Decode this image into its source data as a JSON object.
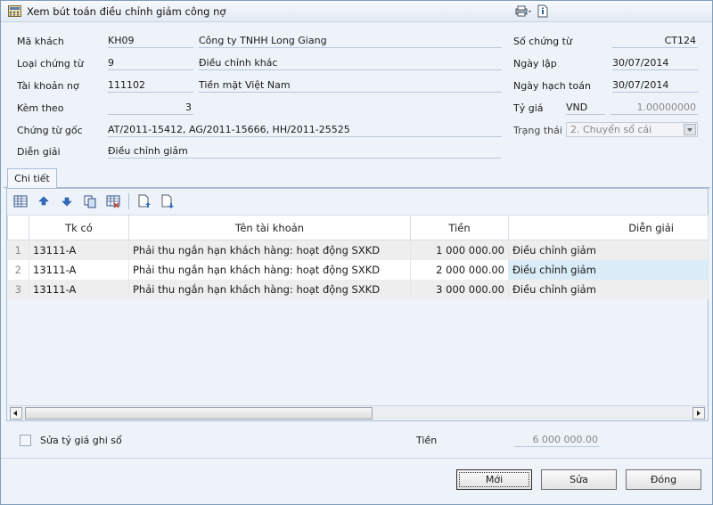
{
  "window": {
    "title": "Xem bút toán điều chỉnh giảm công nợ"
  },
  "header": {
    "ma_khach": {
      "label": "Mã khách",
      "code": "KH09",
      "name": "Công ty TNHH Long Giang"
    },
    "loai_chung_tu": {
      "label": "Loại chứng từ",
      "code": "9",
      "name": "Điều chỉnh khác"
    },
    "tai_khoan_no": {
      "label": "Tài khoản nợ",
      "code": "111102",
      "name": "Tiền mặt Việt Nam"
    },
    "kem_theo": {
      "label": "Kèm theo",
      "value": "3"
    },
    "chung_tu_goc": {
      "label": "Chứng từ gốc",
      "value": "AT/2011-15412, AG/2011-15666, HH/2011-25525"
    },
    "dien_giai": {
      "label": "Diễn giải",
      "value": "Điều chỉnh giảm"
    },
    "so_chung_tu": {
      "label": "Số chứng từ",
      "value": "CT124"
    },
    "ngay_lap": {
      "label": "Ngày lập",
      "value": "30/07/2014"
    },
    "ngay_hach_toan": {
      "label": "Ngày hạch toán",
      "value": "30/07/2014"
    },
    "ty_gia": {
      "label": "Tỷ giá",
      "currency": "VND",
      "rate": "1.00000000"
    },
    "trang_thai": {
      "label": "Trạng thái",
      "value": "2. Chuyển sổ cái"
    }
  },
  "tabs": [
    {
      "label": "Chi tiết"
    }
  ],
  "grid": {
    "columns": [
      "Tk có",
      "Tên tài khoản",
      "Tiền",
      "Diễn giải"
    ],
    "rows": [
      {
        "rn": "1",
        "tk_co": "13111-A",
        "ten_tk": "Phải thu ngắn hạn khách hàng: hoạt động SXKD",
        "tien": "1 000 000.00",
        "dien_giai": "Điều chỉnh giảm"
      },
      {
        "rn": "2",
        "tk_co": "13111-A",
        "ten_tk": "Phải thu ngắn hạn khách hàng: hoạt động SXKD",
        "tien": "2 000 000.00",
        "dien_giai": "Điều chỉnh giảm"
      },
      {
        "rn": "3",
        "tk_co": "13111-A",
        "ten_tk": "Phải thu ngắn hạn khách hàng: hoạt động SXKD",
        "tien": "3 000 000.00",
        "dien_giai": "Điều chỉnh giảm"
      }
    ]
  },
  "footer": {
    "sua_ty_gia_label": "Sửa tỷ giá ghi sổ",
    "tien_label": "Tiền",
    "tien_value": "6 000 000.00"
  },
  "buttons": {
    "moi": "Mới",
    "sua": "Sửa",
    "dong": "Đóng"
  },
  "icons": {
    "app": "calculator-icon",
    "print": "printer-icon",
    "help": "document-info-icon",
    "toolbar": [
      "grid-icon",
      "arrow-up-icon",
      "arrow-down-icon",
      "copy-icon",
      "delete-row-icon",
      "insert-above-icon",
      "insert-below-icon"
    ]
  },
  "colors": {
    "accent": "#7f9db9",
    "panel": "#eef3fa",
    "selected_cell": "#d9ecf7"
  }
}
